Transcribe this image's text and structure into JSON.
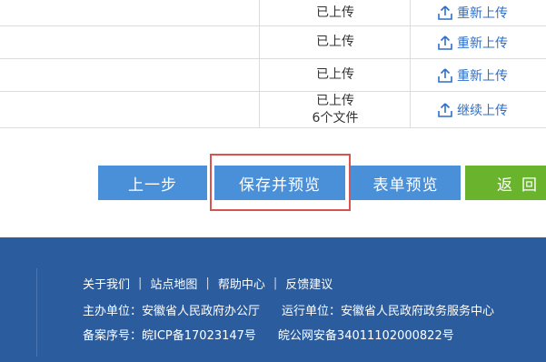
{
  "upload_rows": [
    {
      "status": "已上传",
      "status_sub": "",
      "action": "重新上传"
    },
    {
      "status": "已上传",
      "status_sub": "",
      "action": "重新上传"
    },
    {
      "status": "已上传",
      "status_sub": "",
      "action": "重新上传"
    },
    {
      "status": "已上传",
      "status_sub": "6个文件",
      "action": "继续上传"
    }
  ],
  "buttons": {
    "back": "上一步",
    "save_preview": "保存并预览",
    "form_preview": "表单预览",
    "return": "返回"
  },
  "footer": {
    "links": [
      "关于我们",
      "站点地图",
      "帮助中心",
      "反馈建议"
    ],
    "separator": "|",
    "sponsor": "主办单位：安徽省人民政府办公厅",
    "operator": "运行单位：安徽省人民政府政务服务中心",
    "icp": "备案序号：皖ICP备17023147号",
    "police": "皖公网安备34011102000822号"
  },
  "colors": {
    "primary_button": "#4a90d9",
    "return_button": "#6ab42d",
    "highlight": "#d9534f",
    "footer_bg": "#2b5c9e",
    "link": "#2e6fc9"
  },
  "icons": {
    "upload": "upload-icon"
  }
}
